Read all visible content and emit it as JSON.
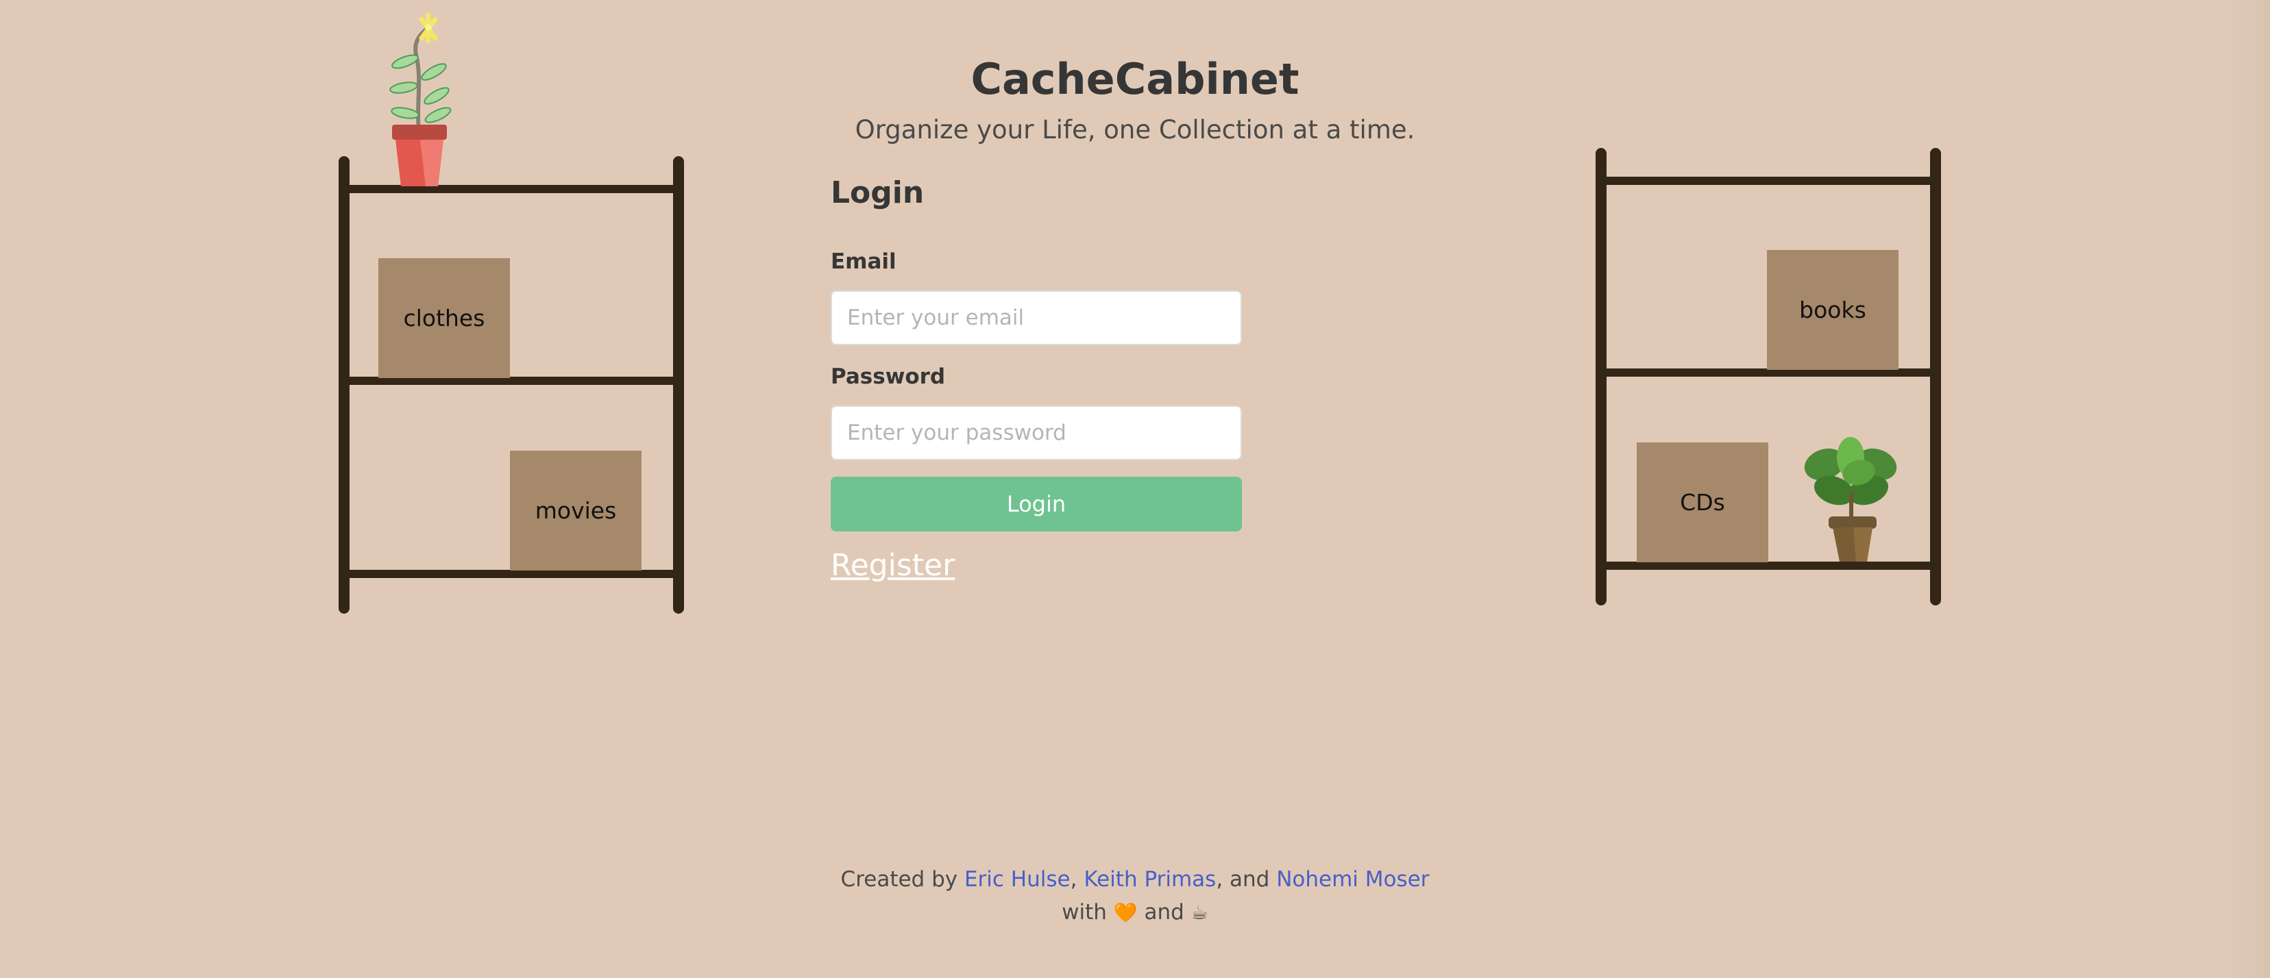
{
  "header": {
    "title": "CacheCabinet",
    "subtitle": "Organize your Life, one Collection at a time."
  },
  "login": {
    "heading": "Login",
    "email_label": "Email",
    "email_placeholder": "Enter your email",
    "email_value": "",
    "password_label": "Password",
    "password_placeholder": "Enter your password",
    "password_value": "",
    "submit_label": "Login",
    "register_label": "Register"
  },
  "shelves": {
    "left_boxes": [
      "clothes",
      "movies"
    ],
    "right_boxes": [
      "books",
      "CDs"
    ]
  },
  "footer": {
    "created_by": "Created by",
    "authors": [
      "Eric Hulse",
      "Keith Primas",
      "Nohemi Moser"
    ],
    "comma": ",",
    "and_text": ", and",
    "with_text": "with",
    "heart_emoji": "🧡",
    "and_word": "and",
    "coffee_emoji": "☕"
  },
  "colors": {
    "background": "#e0cab7",
    "shelf": "#332616",
    "box": "#a5896a",
    "button": "#6fc390",
    "link": "#485fc7"
  },
  "icons": [
    "flower-pot-icon",
    "leafy-plant-icon",
    "heart-emoji",
    "coffee-emoji"
  ]
}
